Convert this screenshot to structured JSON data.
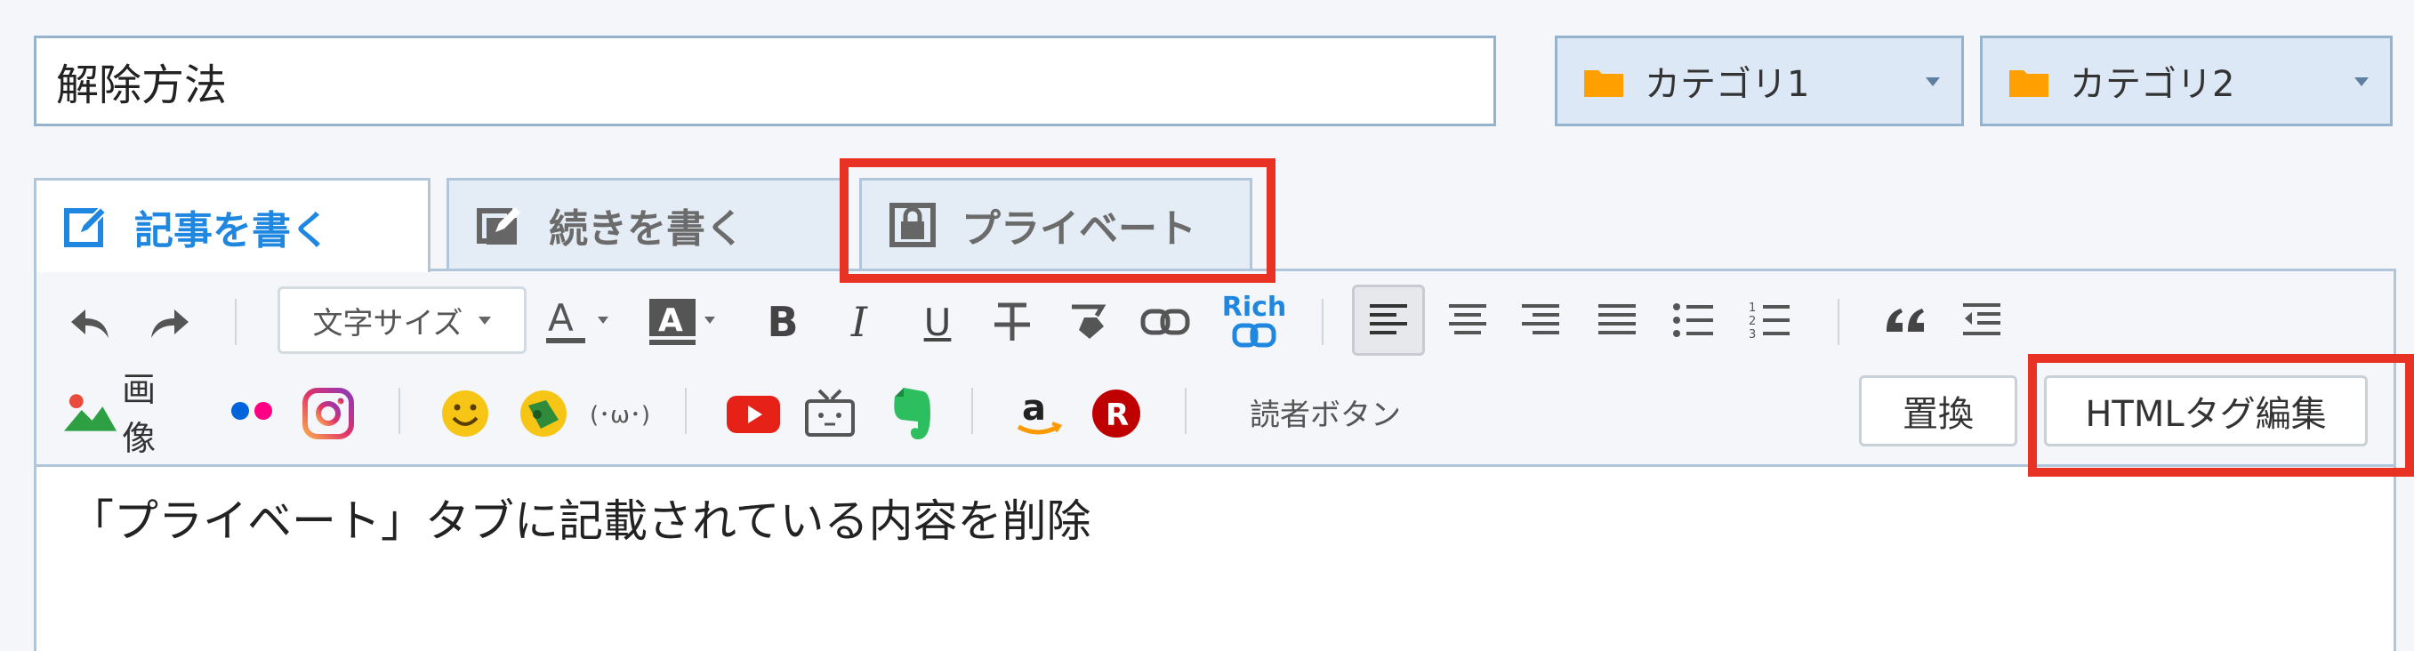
{
  "title": {
    "value": "解除方法"
  },
  "categories": [
    {
      "label": "カテゴリ1"
    },
    {
      "label": "カテゴリ2"
    }
  ],
  "tabs": [
    {
      "label": "記事を書く",
      "active": true,
      "icon": "edit-icon"
    },
    {
      "label": "続きを書く",
      "active": false,
      "icon": "edit-more-icon"
    },
    {
      "label": "プライベート",
      "active": false,
      "icon": "lock-icon"
    }
  ],
  "toolbar": {
    "font_size_label": "文字サイズ",
    "bold_label": "B",
    "italic_label": "I",
    "underline_label": "U",
    "rich_label": "Rich",
    "image_label": "画像",
    "emoticon_label": "(･ω･)",
    "reader_button_label": "読者ボタン",
    "replace_label": "置換",
    "html_edit_label": "HTMLタグ編集"
  },
  "content": {
    "text": "「プライベート」タブに記載されている内容を削除"
  },
  "colors": {
    "accent": "#1f87e0",
    "highlight": "#e83223",
    "folder": "#ff9f00"
  }
}
